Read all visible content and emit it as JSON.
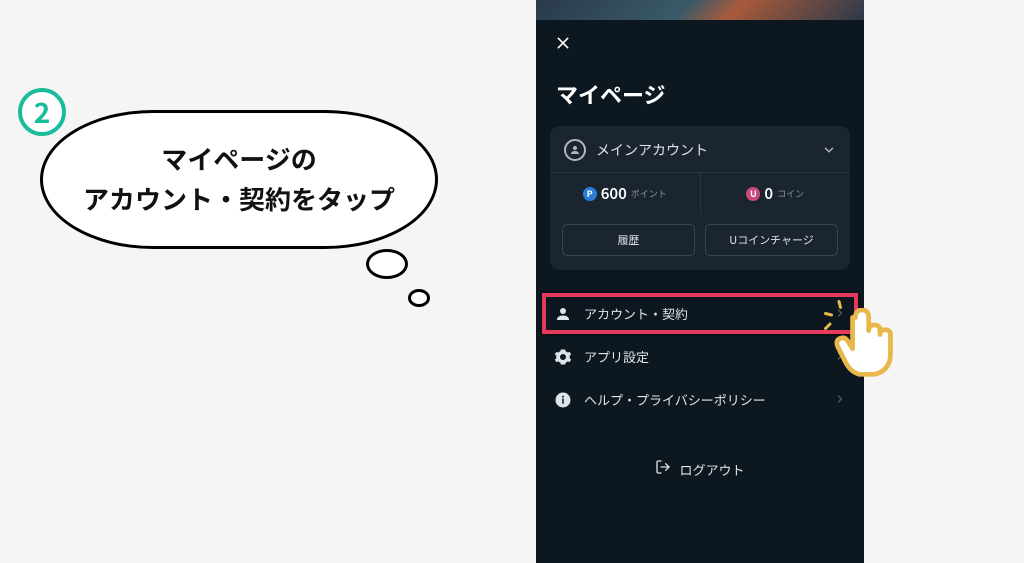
{
  "step": "2",
  "bubble": {
    "line1": "マイページの",
    "line2": "アカウント・契約をタップ"
  },
  "mypage": {
    "title": "マイページ",
    "account_name": "メインアカウント",
    "points": {
      "badge": "P",
      "amount": "600",
      "unit": "ポイント"
    },
    "coins": {
      "badge": "U",
      "amount": "0",
      "unit": "コイン"
    },
    "history_btn": "履歴",
    "charge_btn": "Uコインチャージ",
    "menu": {
      "account_contract": "アカウント・契約",
      "app_settings": "アプリ設定",
      "help_privacy": "ヘルプ・プライバシーポリシー"
    },
    "logout": "ログアウト"
  }
}
